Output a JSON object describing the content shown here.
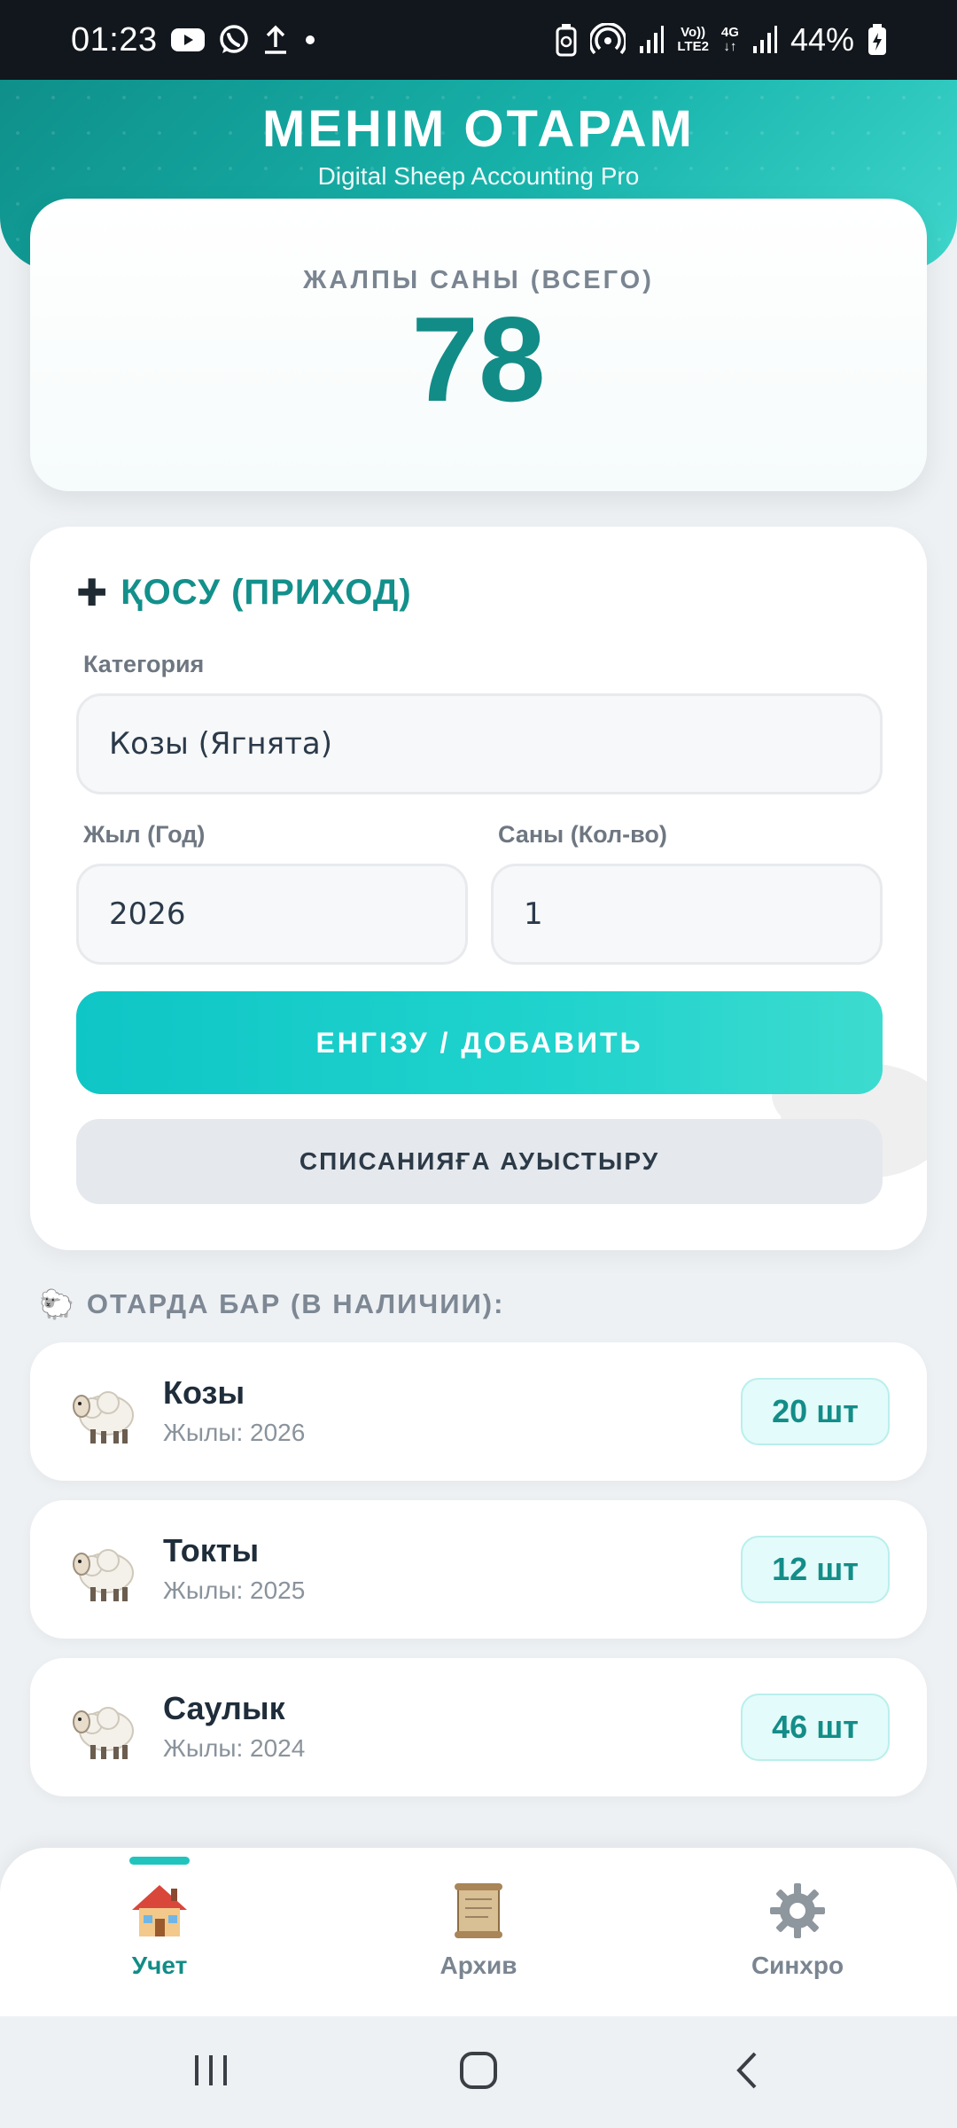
{
  "status_bar": {
    "time": "01:23",
    "battery": "44%",
    "network_volte": "Vo))",
    "network_lte": "LTE2",
    "network_4g": "4G",
    "icons": [
      "youtube-icon",
      "whatsapp-icon",
      "upload-icon",
      "dot-icon",
      "battery-saver-icon",
      "hotspot-icon",
      "signal-icon",
      "signal-icon",
      "battery-icon"
    ]
  },
  "header": {
    "title": "МЕНІМ ОТАРАМ",
    "subtitle": "Digital Sheep Accounting Pro"
  },
  "total": {
    "label": "ЖАЛПЫ САНЫ (ВСЕГО)",
    "value": "78"
  },
  "form": {
    "title": "ҚОСУ (ПРИХОД)",
    "title_icon": "plus-icon",
    "category_label": "Категория",
    "category_value": "Козы (Ягнята)",
    "year_label": "Жыл (Год)",
    "year_value": "2026",
    "count_label": "Саны (Кол-во)",
    "count_value": "1",
    "submit_label": "ЕНГІЗУ / ДОБАВИТЬ",
    "switch_label": "СПИСАНИЯҒА АУЫСТЫРУ"
  },
  "flock": {
    "heading": "ОТАРДА БАР (В НАЛИЧИИ):",
    "heading_icon": "🐑",
    "items": [
      {
        "name": "Козы",
        "year": "Жылы: 2026",
        "count": "20 шт",
        "icon": "sheep-icon"
      },
      {
        "name": "Токты",
        "year": "Жылы: 2025",
        "count": "12 шт",
        "icon": "sheep-icon"
      },
      {
        "name": "Саулык",
        "year": "Жылы: 2024",
        "count": "46 шт",
        "icon": "sheep-icon"
      }
    ]
  },
  "bottom_nav": {
    "items": [
      {
        "label": "Учет",
        "icon": "house-icon",
        "active": true
      },
      {
        "label": "Архив",
        "icon": "scroll-icon",
        "active": false
      },
      {
        "label": "Синхро",
        "icon": "gear-icon",
        "active": false
      }
    ]
  },
  "colors": {
    "accent": "#128c87",
    "header_gradient_start": "#0f8f8a",
    "header_gradient_end": "#3fd6cc",
    "button_primary": "#20d3cd",
    "badge_bg": "#e3fbfa"
  }
}
